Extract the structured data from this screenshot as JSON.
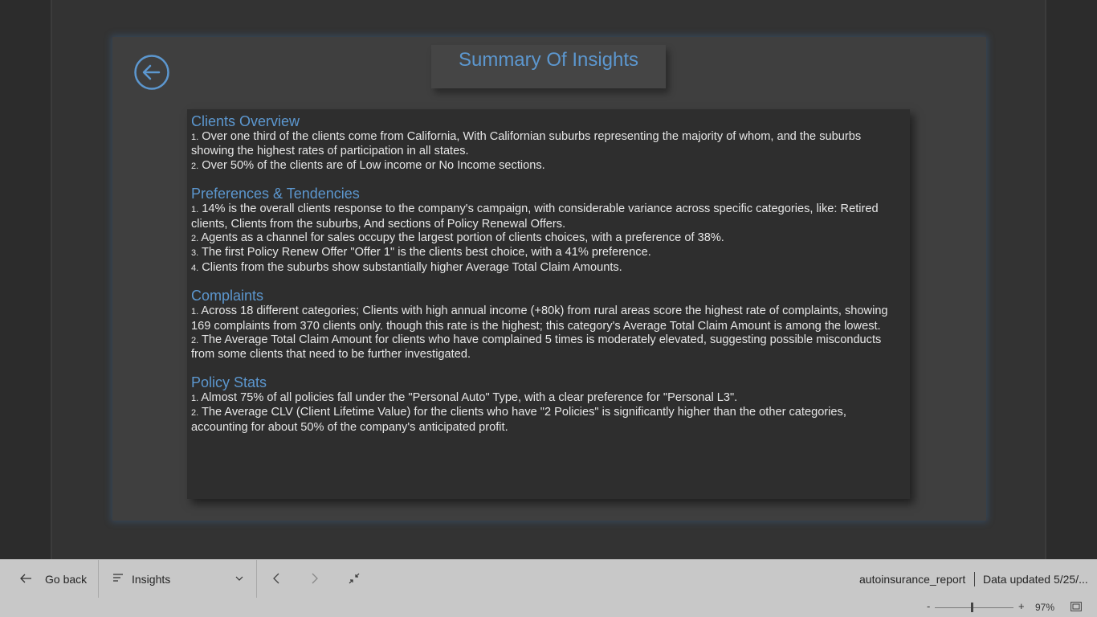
{
  "report": {
    "title": "Summary Of Insights",
    "sections": [
      {
        "title": "Clients Overview",
        "items": [
          {
            "num": "1.",
            "text": " Over one third of the clients come from California, With Californian suburbs representing the majority of whom, and the suburbs showing the highest rates of participation in all states."
          },
          {
            "num": "2.",
            "text": " Over 50% of the clients are of Low income or No Income sections."
          }
        ]
      },
      {
        "title": "Preferences & Tendencies",
        "items": [
          {
            "num": "1.",
            "text": " 14% is the overall clients response to the company's campaign, with considerable variance across specific categories, like: Retired clients, Clients from the suburbs, And sections of Policy Renewal Offers."
          },
          {
            "num": "2.",
            "text": " Agents as a channel for sales occupy the largest portion of clients choices, with a preference of 38%."
          },
          {
            "num": "3.",
            "text": " The first Policy Renew Offer \"Offer 1\" is the clients best choice, with a 41% preference."
          },
          {
            "num": "4.",
            "text": " Clients from the suburbs show substantially higher Average Total Claim Amounts."
          }
        ]
      },
      {
        "title": "Complaints",
        "items": [
          {
            "num": "1.",
            "text": " Across 18 different categories; Clients with high annual income (+80k) from rural areas score the highest rate of complaints, showing 169 complaints from 370 clients only. though this rate is the highest; this category's Average Total Claim Amount is among the lowest."
          },
          {
            "num": "2.",
            "text": " The Average Total Claim Amount for clients who have complained 5 times is moderately elevated, suggesting possible misconducts from some clients that need to be further investigated."
          }
        ]
      },
      {
        "title": "Policy Stats",
        "items": [
          {
            "num": "1.",
            "text": " Almost 75% of all policies fall under the \"Personal Auto\" Type, with a clear preference for \"Personal L3\"."
          },
          {
            "num": "2.",
            "text": " The Average CLV (Client Lifetime Value) for the clients who have \"2 Policies\" is significantly higher than the other categories, accounting for about 50% of the company's anticipated profit."
          }
        ]
      }
    ]
  },
  "bottom_bar": {
    "go_back_label": "Go back",
    "page_selector_label": "Insights",
    "report_name": "autoinsurance_report",
    "data_updated": "Data updated 5/25/..."
  },
  "zoom": {
    "minus": "-",
    "plus": "+",
    "percent": "97%",
    "level": 0.47
  },
  "colors": {
    "accent": "#5c97cf",
    "background": "#2c2c2c",
    "bar": "#c8c8c8"
  },
  "icons": {
    "back_circle": "arrow-left-circle-icon",
    "go_back": "arrow-left-icon",
    "page_list": "list-icon",
    "dropdown": "chevron-down-icon",
    "prev": "chevron-left-icon",
    "next": "chevron-right-icon",
    "collapse": "collapse-icon",
    "fit": "fit-to-page-icon"
  }
}
